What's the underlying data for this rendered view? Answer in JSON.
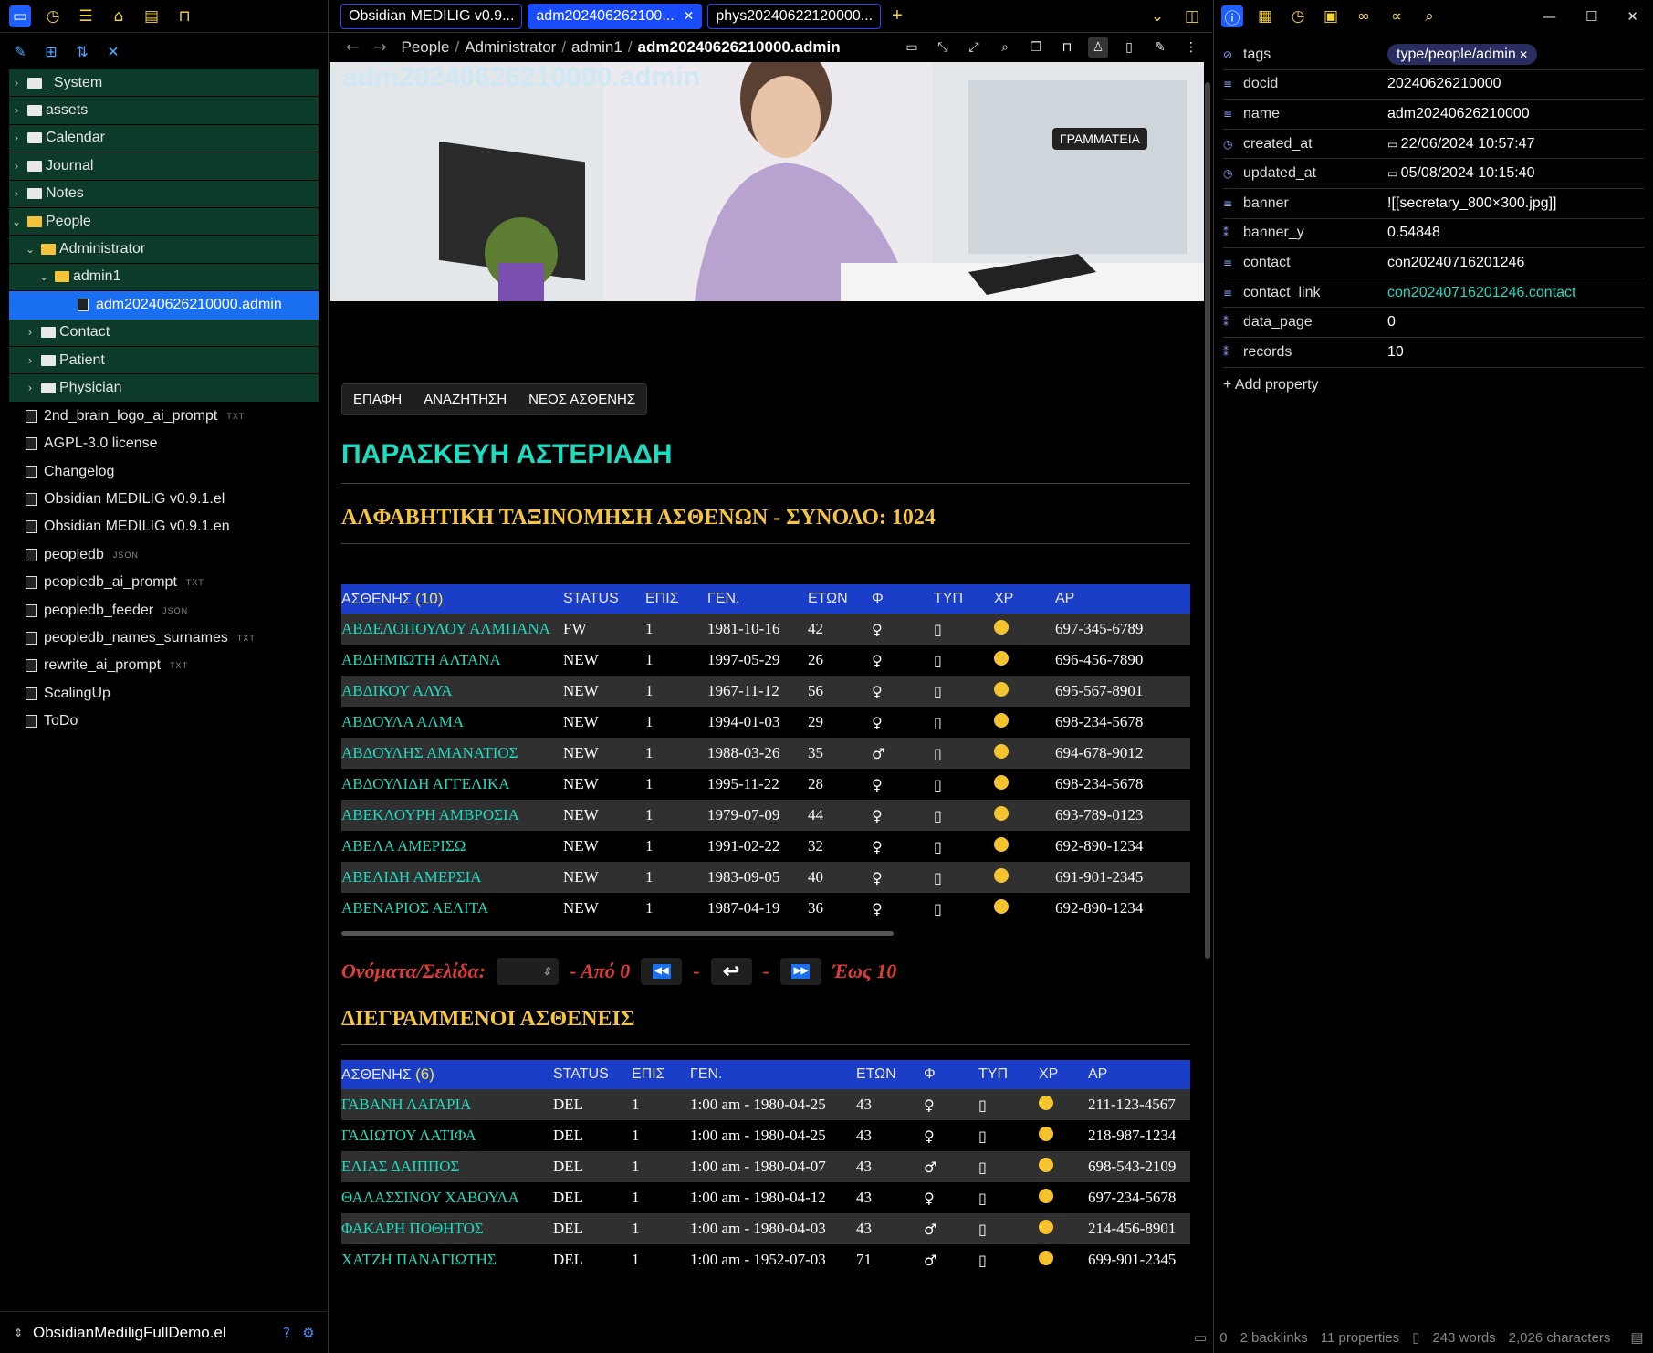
{
  "left": {
    "tree": [
      {
        "label": "_System",
        "type": "folder",
        "depth": 0,
        "open": false
      },
      {
        "label": "assets",
        "type": "folder",
        "depth": 0,
        "open": false
      },
      {
        "label": "Calendar",
        "type": "folder",
        "depth": 0,
        "open": false
      },
      {
        "label": "Journal",
        "type": "folder",
        "depth": 0,
        "open": false
      },
      {
        "label": "Notes",
        "type": "folder",
        "depth": 0,
        "open": false
      },
      {
        "label": "People",
        "type": "folder",
        "depth": 0,
        "open": true
      },
      {
        "label": "Administrator",
        "type": "folder",
        "depth": 1,
        "open": true
      },
      {
        "label": "admin1",
        "type": "folder",
        "depth": 2,
        "open": true
      },
      {
        "label": "adm20240626210000.admin",
        "type": "note",
        "depth": 3,
        "active": true
      },
      {
        "label": "Contact",
        "type": "folder",
        "depth": 1,
        "open": false
      },
      {
        "label": "Patient",
        "type": "folder",
        "depth": 1,
        "open": false
      },
      {
        "label": "Physician",
        "type": "folder",
        "depth": 1,
        "open": false
      }
    ],
    "files": [
      {
        "label": "2nd_brain_logo_ai_prompt",
        "ext": "TXT"
      },
      {
        "label": "AGPL-3.0 license",
        "ext": ""
      },
      {
        "label": "Changelog",
        "ext": ""
      },
      {
        "label": "Obsidian MEDILIG v0.9.1.el",
        "ext": ""
      },
      {
        "label": "Obsidian MEDILIG v0.9.1.en",
        "ext": ""
      },
      {
        "label": "peopledb",
        "ext": "JSON"
      },
      {
        "label": "peopledb_ai_prompt",
        "ext": "TXT"
      },
      {
        "label": "peopledb_feeder",
        "ext": "JSON"
      },
      {
        "label": "peopledb_names_surnames",
        "ext": "TXT"
      },
      {
        "label": "rewrite_ai_prompt",
        "ext": "TXT"
      },
      {
        "label": "ScalingUp",
        "ext": ""
      },
      {
        "label": "ToDo",
        "ext": ""
      }
    ],
    "vault_name": "ObsidianMediligFullDemo.el"
  },
  "tabs": [
    {
      "label": "Obsidian MEDILIG v0.9...",
      "active": false
    },
    {
      "label": "adm202406262100...",
      "active": true
    },
    {
      "label": "phys20240622120000...",
      "active": false
    }
  ],
  "breadcrumb": [
    "People",
    "Administrator",
    "admin1",
    "adm20240626210000.admin"
  ],
  "note": {
    "title": "adm20240626210000.admin",
    "tooltip": "ΓΡΑΜΜΑΤΕΙΑ",
    "buttons": [
      "ΕΠΑΦΗ",
      "ΑΝΑΖΗΤΗΣΗ",
      "ΝΕΟΣ ΑΣΘΕΝΗΣ"
    ],
    "person": "ΠΑΡΑΣΚΕΥΗ ΑΣΤΕΡΙΑΔΗ",
    "section1": "ΑΛΦΑΒΗΤΙΚΗ ΤΑΞΙΝΟΜΗΣΗ ΑΣΘΕΝΩΝ - ΣΥΝΟΛΟ: 1024",
    "section2": "ΔΙΕΓΡΑΜΜΕΝΟΙ ΑΣΘΕΝΕΙΣ",
    "headers": {
      "patient": "ΑΣΘΕΝΗΣ",
      "status": "STATUS",
      "visits": "ΕΠΙΣ",
      "dob": "ΓΕΝ.",
      "age": "ΕΤΩΝ",
      "sex": "Φ",
      "type": "ΤΥΠ",
      "color": "ΧΡ",
      "phone": "ΑΡ"
    },
    "count1": "(10)",
    "count2": "(6)",
    "patients": [
      {
        "name": "ΑΒΔΕΛΟΠΟΥΛΟΥ ΑΛΜΠΑΝΑ",
        "status": "FW",
        "visits": "1",
        "dob": "1981-10-16",
        "age": "42",
        "sex": "♀",
        "phone": "697-345-6789"
      },
      {
        "name": "ΑΒΔΗΜΙΩΤΗ ΑΛΤΑΝΑ",
        "status": "NEW",
        "visits": "1",
        "dob": "1997-05-29",
        "age": "26",
        "sex": "♀",
        "phone": "696-456-7890"
      },
      {
        "name": "ΑΒΔΙΚΟΥ ΑΛΥΑ",
        "status": "NEW",
        "visits": "1",
        "dob": "1967-11-12",
        "age": "56",
        "sex": "♀",
        "phone": "695-567-8901"
      },
      {
        "name": "ΑΒΔΟΥΛΑ ΑΛΜΑ",
        "status": "NEW",
        "visits": "1",
        "dob": "1994-01-03",
        "age": "29",
        "sex": "♀",
        "phone": "698-234-5678"
      },
      {
        "name": "ΑΒΔΟΥΛΗΣ ΑΜΑΝΑΤΙΟΣ",
        "status": "NEW",
        "visits": "1",
        "dob": "1988-03-26",
        "age": "35",
        "sex": "♂",
        "phone": "694-678-9012"
      },
      {
        "name": "ΑΒΔΟΥΛΙΔΗ ΑΓΓΕΛΙΚΑ",
        "status": "NEW",
        "visits": "1",
        "dob": "1995-11-22",
        "age": "28",
        "sex": "♀",
        "phone": "698-234-5678"
      },
      {
        "name": "ΑΒΕΚΛΟΥΡΗ ΑΜΒΡΟΣΙΑ",
        "status": "NEW",
        "visits": "1",
        "dob": "1979-07-09",
        "age": "44",
        "sex": "♀",
        "phone": "693-789-0123"
      },
      {
        "name": "ΑΒΕΛΑ ΑΜΕΡΙΣΩ",
        "status": "NEW",
        "visits": "1",
        "dob": "1991-02-22",
        "age": "32",
        "sex": "♀",
        "phone": "692-890-1234"
      },
      {
        "name": "ΑΒΕΛΙΔΗ ΑΜΕΡΣΙΑ",
        "status": "NEW",
        "visits": "1",
        "dob": "1983-09-05",
        "age": "40",
        "sex": "♀",
        "phone": "691-901-2345"
      },
      {
        "name": "ΑΒΕΝΑΡΙΟΣ ΑΕΛΙΤΑ",
        "status": "NEW",
        "visits": "1",
        "dob": "1987-04-19",
        "age": "36",
        "sex": "♀",
        "phone": "692-890-1234"
      }
    ],
    "pager": {
      "label": "Ονόματα/Σελίδα:",
      "from": "- Από 0",
      "to": "Έως 10",
      "dash": "-"
    },
    "deleted": [
      {
        "name": "ΓΑΒΑΝΗ ΛΑΓΑΡΙΑ",
        "status": "DEL",
        "visits": "1",
        "dob": "1:00 am - 1980-04-25",
        "age": "43",
        "sex": "♀",
        "phone": "211-123-4567"
      },
      {
        "name": "ΓΑΔΙΩΤΟΥ ΛΑΤΙΦΑ",
        "status": "DEL",
        "visits": "1",
        "dob": "1:00 am - 1980-04-25",
        "age": "43",
        "sex": "♀",
        "phone": "218-987-1234"
      },
      {
        "name": "ΕΛΙΑΣ ΔΑΙΠΠΟΣ",
        "status": "DEL",
        "visits": "1",
        "dob": "1:00 am - 1980-04-07",
        "age": "43",
        "sex": "♂",
        "phone": "698-543-2109"
      },
      {
        "name": "ΘΑΛΑΣΣΙΝΟΥ ΧΑΒΟΥΛΑ",
        "status": "DEL",
        "visits": "1",
        "dob": "1:00 am - 1980-04-12",
        "age": "43",
        "sex": "♀",
        "phone": "697-234-5678"
      },
      {
        "name": "ΦΑΚΑΡΗ ΠΟΘΗΤΟΣ",
        "status": "DEL",
        "visits": "1",
        "dob": "1:00 am - 1980-04-03",
        "age": "43",
        "sex": "♂",
        "phone": "214-456-8901"
      },
      {
        "name": "ΧΑΤΖΗ ΠΑΝΑΓΙΩΤΗΣ",
        "status": "DEL",
        "visits": "1",
        "dob": "1:00 am - 1952-07-03",
        "age": "71",
        "sex": "♂",
        "phone": "699-901-2345"
      }
    ]
  },
  "properties": [
    {
      "key": "tags",
      "value": "type/people/admin",
      "kind": "tag",
      "icon": "tag-icon"
    },
    {
      "key": "docid",
      "value": "20240626210000",
      "kind": "text",
      "icon": "text-icon"
    },
    {
      "key": "name",
      "value": "adm20240626210000",
      "kind": "text",
      "icon": "text-icon"
    },
    {
      "key": "created_at",
      "value": "22/06/2024 10:57:47",
      "kind": "date",
      "icon": "clock-icon"
    },
    {
      "key": "updated_at",
      "value": "05/08/2024 10:15:40",
      "kind": "date",
      "icon": "clock-icon"
    },
    {
      "key": "banner",
      "value": "![[secretary_800×300.jpg]]",
      "kind": "text",
      "icon": "text-icon"
    },
    {
      "key": "banner_y",
      "value": "0.54848",
      "kind": "text",
      "icon": "number-icon"
    },
    {
      "key": "contact",
      "value": "con20240716201246",
      "kind": "text",
      "icon": "text-icon"
    },
    {
      "key": "contact_link",
      "value": "con20240716201246.contact",
      "kind": "link",
      "icon": "text-icon"
    },
    {
      "key": "data_page",
      "value": "0",
      "kind": "text",
      "icon": "number-icon"
    },
    {
      "key": "records",
      "value": "10",
      "kind": "text",
      "icon": "number-icon"
    }
  ],
  "add_property": "+ Add property",
  "status_bar": {
    "comments": "0",
    "backlinks": "2 backlinks",
    "properties": "11 properties",
    "words": "243 words",
    "chars": "2,026 characters"
  },
  "colors": {
    "accent": "#1a6ef0",
    "teal": "#1ddcc0",
    "gold": "#f5c542",
    "folder_bg": "#0c3b2a",
    "table_header": "#1a3ec8"
  }
}
